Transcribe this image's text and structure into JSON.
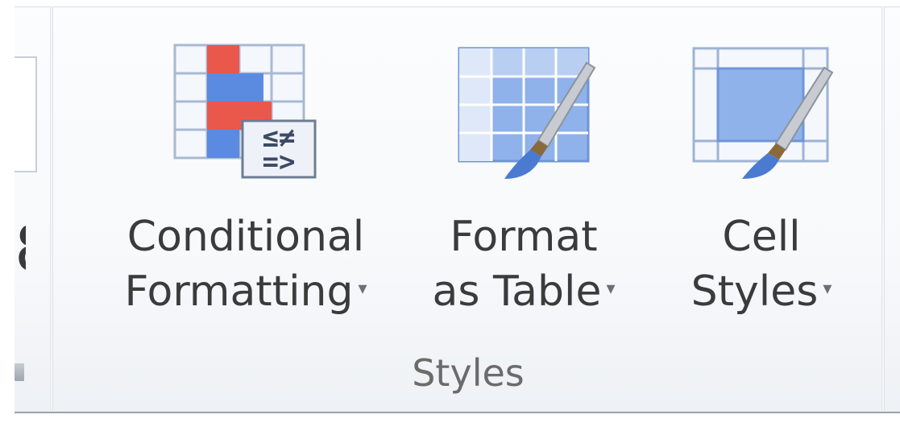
{
  "group": {
    "title": "Styles",
    "buttons": [
      {
        "line1": "Conditional",
        "line2": "Formatting",
        "dropdown": "▾",
        "icon": "conditional-formatting-icon"
      },
      {
        "line1": "Format",
        "line2": "as Table",
        "dropdown": "▾",
        "icon": "format-as-table-icon"
      },
      {
        "line1": "Cell",
        "line2": "Styles",
        "dropdown": "▾",
        "icon": "cell-styles-icon"
      }
    ]
  },
  "colors": {
    "grid_blue": "#6f95d7",
    "grid_fill": "#8fb2ea",
    "highlight_red": "#e9584a",
    "brush_brown": "#8a6a3a"
  }
}
